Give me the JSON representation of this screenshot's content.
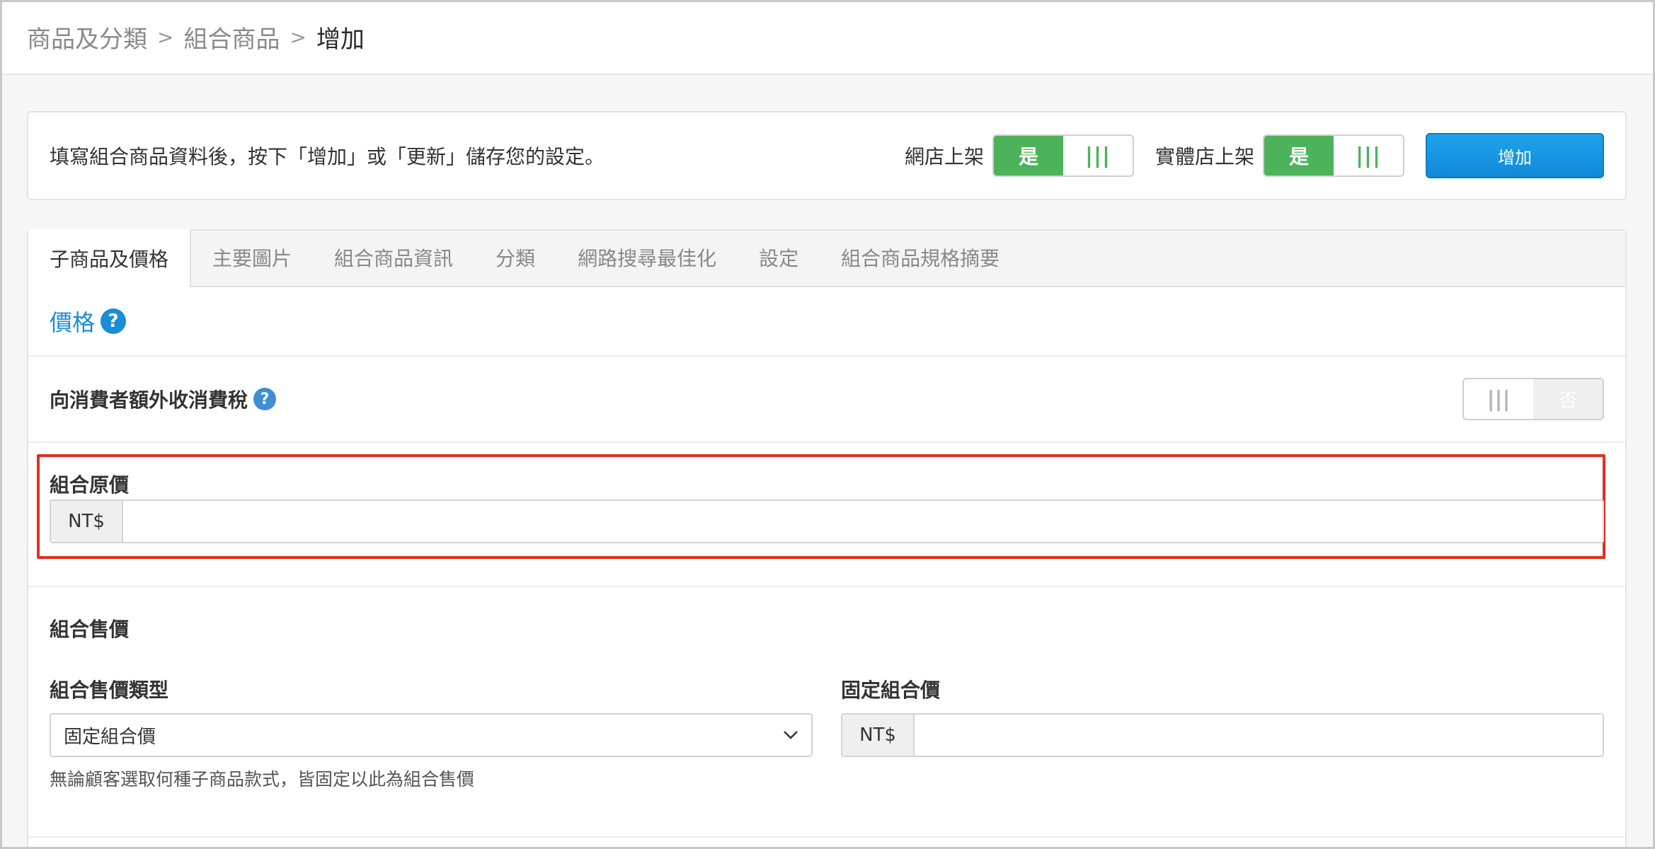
{
  "breadcrumb": {
    "items": [
      "商品及分類",
      "組合商品",
      "增加"
    ],
    "separator": ">"
  },
  "action_bar": {
    "hint": "填寫組合商品資料後，按下「增加」或「更新」儲存您的設定。",
    "online_store": {
      "label": "網店上架",
      "on_label": "是",
      "off_glyph": "|||",
      "state": "on"
    },
    "physical_store": {
      "label": "實體店上架",
      "on_label": "是",
      "off_glyph": "|||",
      "state": "on"
    },
    "add_button": "增加"
  },
  "tabs": [
    {
      "label": "子商品及價格",
      "active": true
    },
    {
      "label": "主要圖片",
      "active": false
    },
    {
      "label": "組合商品資訊",
      "active": false
    },
    {
      "label": "分類",
      "active": false
    },
    {
      "label": "網路搜尋最佳化",
      "active": false
    },
    {
      "label": "設定",
      "active": false
    },
    {
      "label": "組合商品規格摘要",
      "active": false
    }
  ],
  "price_section": {
    "heading": "價格",
    "help_glyph": "?"
  },
  "tax": {
    "label": "向消費者額外收消費稅",
    "help_glyph": "?",
    "on_glyph": "|||",
    "off_label": "否",
    "state": "off"
  },
  "original_price": {
    "label": "組合原價",
    "currency": "NT$",
    "value": ""
  },
  "sale_price": {
    "heading": "組合售價",
    "type_label": "組合售價類型",
    "type_value": "固定組合價",
    "type_help": "無論顧客選取何種子商品款式，皆固定以此為組合售價",
    "fixed_label": "固定組合價",
    "currency": "NT$",
    "fixed_value": ""
  },
  "colors": {
    "accent_blue": "#1a8cd8",
    "toggle_green": "#4cb35a",
    "highlight_red": "#e0301e"
  }
}
